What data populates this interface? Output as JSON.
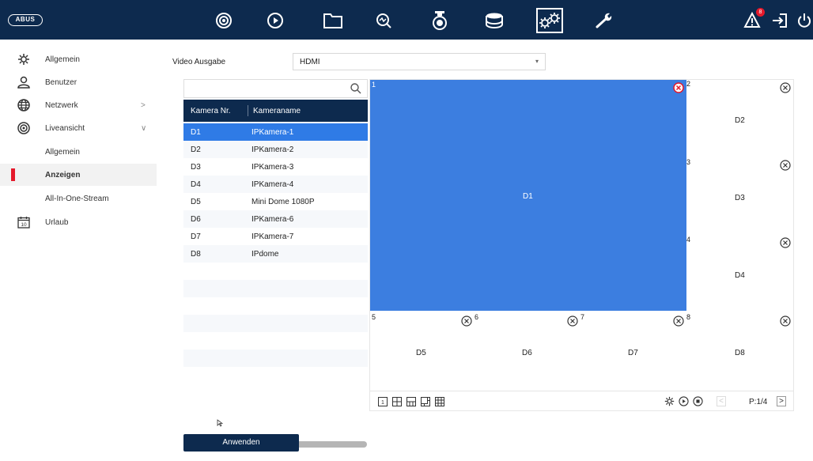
{
  "header": {
    "logo_text": "ABUS",
    "nav_icons": [
      "live-view-icon",
      "playback-icon",
      "file-icon",
      "analysis-icon",
      "camera-icon",
      "storage-icon",
      "configuration-icon",
      "maintenance-icon"
    ],
    "active_icon": "configuration-icon",
    "right_icons": [
      "alarm-icon",
      "logout-icon",
      "power-icon"
    ],
    "alarm_badge": "8"
  },
  "sidebar": {
    "items": [
      {
        "label": "Allgemein",
        "icon": "gear-icon"
      },
      {
        "label": "Benutzer",
        "icon": "user-icon"
      },
      {
        "label": "Netzwerk",
        "icon": "globe-icon",
        "chevron": ">"
      },
      {
        "label": "Liveansicht",
        "icon": "live-view-icon",
        "chevron": "∨"
      },
      {
        "label": "Allgemein"
      },
      {
        "label": "Anzeigen"
      },
      {
        "label": "All-In-One-Stream"
      },
      {
        "label": "Urlaub",
        "icon": "calendar-icon",
        "calendar_day": "10"
      }
    ]
  },
  "main": {
    "video_output_label": "Video Ausgabe",
    "video_output_value": "HDMI",
    "table": {
      "col1": "Kamera Nr.",
      "col2": "Kameraname",
      "rows": [
        {
          "nr": "D1",
          "name": "IPKamera-1"
        },
        {
          "nr": "D2",
          "name": "IPKamera-2"
        },
        {
          "nr": "D3",
          "name": "IPKamera-3"
        },
        {
          "nr": "D4",
          "name": "IPKamera-4"
        },
        {
          "nr": "D5",
          "name": "Mini Dome 1080P"
        },
        {
          "nr": "D6",
          "name": "IPKamera-6"
        },
        {
          "nr": "D7",
          "name": "IPKamera-7"
        },
        {
          "nr": "D8",
          "name": "IPdome"
        }
      ]
    },
    "grid": {
      "cells": [
        {
          "num": "1",
          "name": "D1"
        },
        {
          "num": "2",
          "name": "D2"
        },
        {
          "num": "3",
          "name": "D3"
        },
        {
          "num": "4",
          "name": "D4"
        },
        {
          "num": "5",
          "name": "D5"
        },
        {
          "num": "6",
          "name": "D6"
        },
        {
          "num": "7",
          "name": "D7"
        },
        {
          "num": "8",
          "name": "D8"
        }
      ],
      "page_indicator": "P:1/4"
    },
    "apply_label": "Anwenden",
    "colors": {
      "accent": "#2f7be6",
      "header": "#0d2a4e",
      "selected_cell": "#3c7ee0",
      "marker": "#e5192b"
    }
  }
}
